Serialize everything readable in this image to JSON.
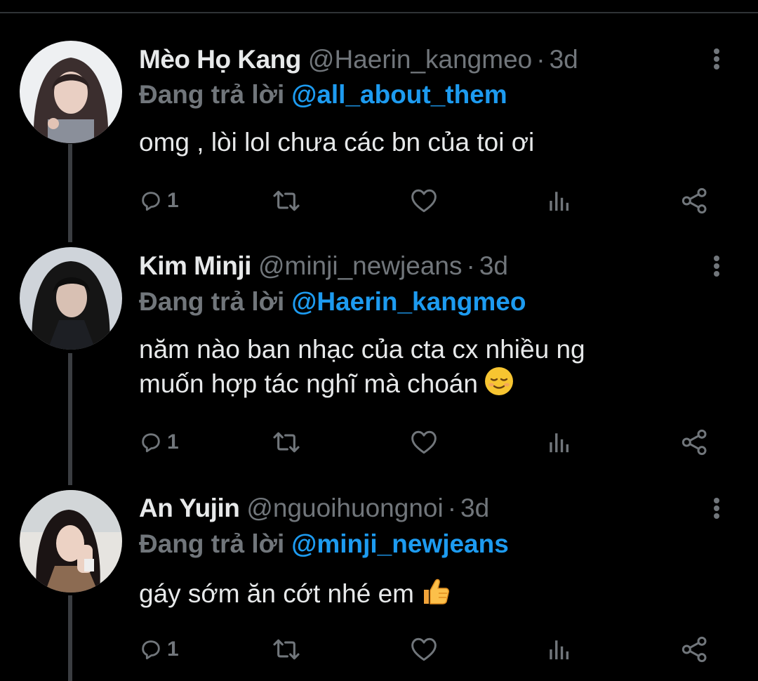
{
  "colors": {
    "background": "#000000",
    "primary_text": "#e7e9ea",
    "secondary_text": "#71767b",
    "link": "#1d9bf0",
    "thread_line": "#3a3d41"
  },
  "thread": [
    {
      "display_name": "Mèo Họ Kang",
      "handle": "@Haerin_kangmeo",
      "separator": "·",
      "time": "3d",
      "reply_prefix": "Đang trả lời",
      "reply_to": "@all_about_them",
      "text_lines": [
        "omg , lòi lol chưa các bn của toi ơi"
      ],
      "emoji": "",
      "reply_count": "1",
      "icons": {
        "more": "more-vertical-icon",
        "reply": "reply-icon",
        "retweet": "retweet-icon",
        "like": "heart-icon",
        "views": "analytics-icon",
        "share": "share-icon"
      }
    },
    {
      "display_name": "Kim Minji",
      "handle": "@minji_newjeans",
      "separator": "·",
      "time": "3d",
      "reply_prefix": "Đang trả lời",
      "reply_to": "@Haerin_kangmeo",
      "text_lines": [
        "năm nào ban nhạc của cta cx nhiều ng",
        "muốn hợp tác nghĩ mà choán"
      ],
      "emoji": "relieved-face-emoji",
      "reply_count": "1"
    },
    {
      "display_name": "An Yujin",
      "handle": "@nguoihuongnoi",
      "separator": "·",
      "time": "3d",
      "reply_prefix": "Đang trả lời",
      "reply_to": "@minji_newjeans",
      "text_lines": [
        "gáy sớm ăn cớt nhé em"
      ],
      "emoji": "thumbs-up-emoji",
      "reply_count": "1"
    }
  ]
}
